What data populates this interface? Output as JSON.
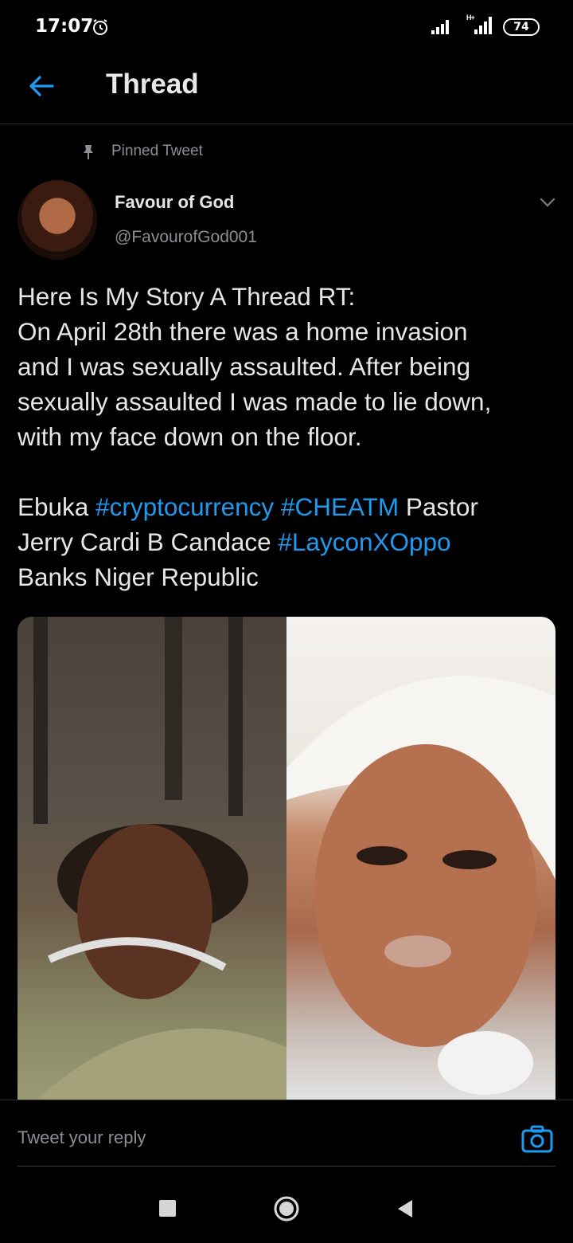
{
  "status_bar": {
    "time": "17:07",
    "network": "H+",
    "battery": "74"
  },
  "header": {
    "title": "Thread"
  },
  "tweet": {
    "pinned_label": "Pinned Tweet",
    "author_name": "Favour of God",
    "author_handle": "@FavourofGod001",
    "lines": [
      "Here Is My Story A Thread RT:",
      "On April 28th there was a home invasion",
      "and I was sexually assaulted. After being",
      "sexually assaulted I was made to lie down,",
      "with my face down on the floor."
    ],
    "tags_line1": {
      "t1": "Ebuka ",
      "h1": "#cryptocurrency",
      "t2": " ",
      "h2": "#CHEATM",
      "t3": " Pastor"
    },
    "tags_line2": {
      "t1": "Jerry Cardi B Candace ",
      "h1": "#LayconXOppo"
    },
    "tags_line3": "Banks Niger Republic"
  },
  "reply": {
    "placeholder": "Tweet your reply"
  },
  "colors": {
    "background": "#000000",
    "accent": "#1d9bf0",
    "secondary_text": "#8b8f93"
  },
  "icons": [
    "alarm-icon",
    "signal-icon",
    "back-arrow-icon",
    "pin-icon",
    "chevron-down-icon",
    "camera-icon",
    "recents-icon",
    "home-icon",
    "back-icon"
  ]
}
